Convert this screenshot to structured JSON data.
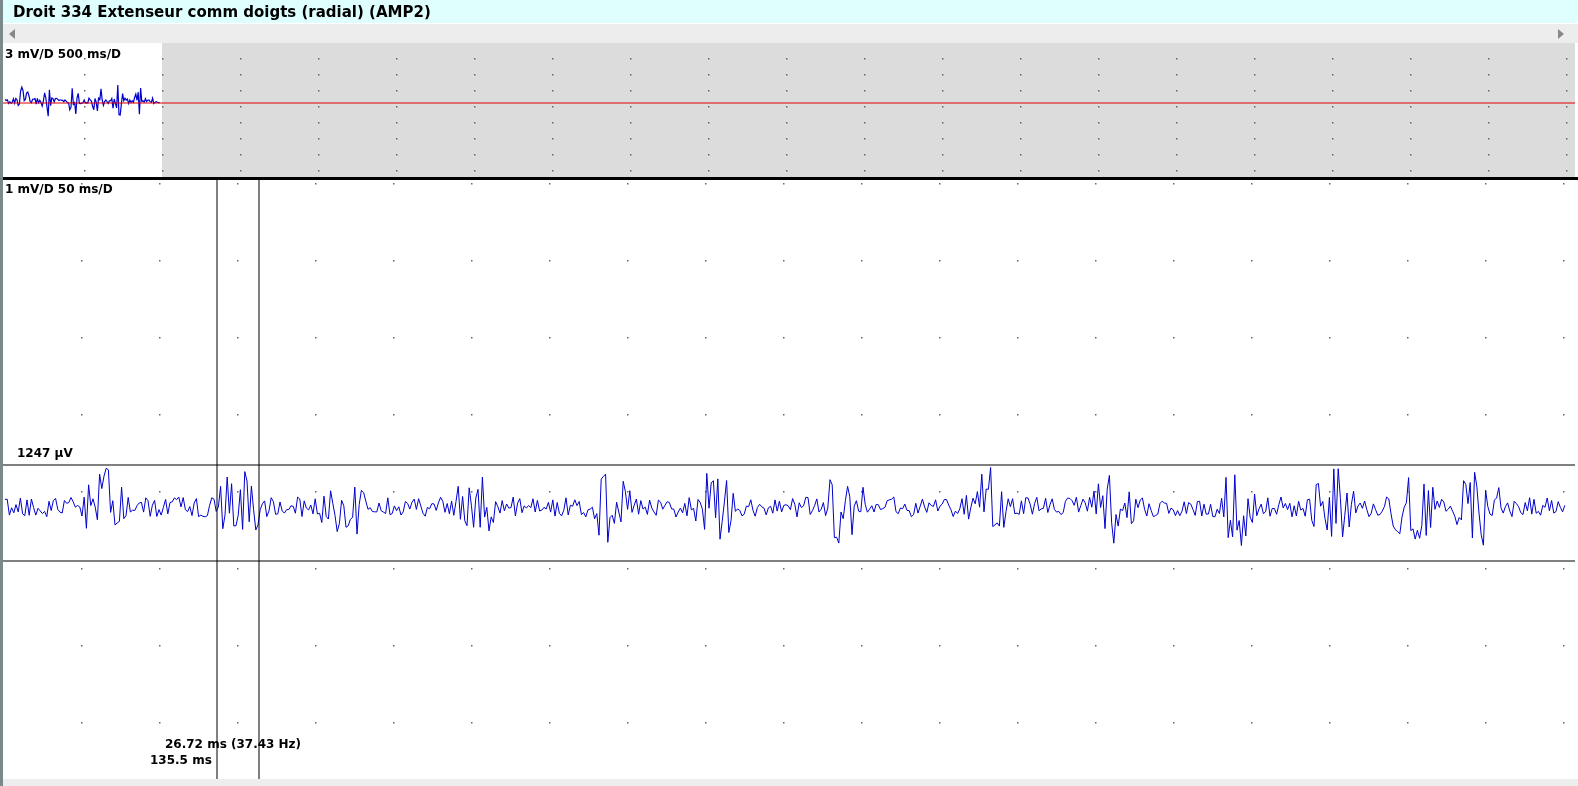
{
  "window": {
    "title": "Droit 334 Extenseur comm doigts (radial) (AMP2)"
  },
  "overview_trace": {
    "scale_label": "3 mV/D 500 ms/D"
  },
  "detail_trace": {
    "scale_label": "1 mV/D 50 ms/D",
    "amplitude_label": "1247 µV",
    "interval_reading": "26.72 ms (37.43 Hz)",
    "latency_reading": "135.5 ms"
  }
}
